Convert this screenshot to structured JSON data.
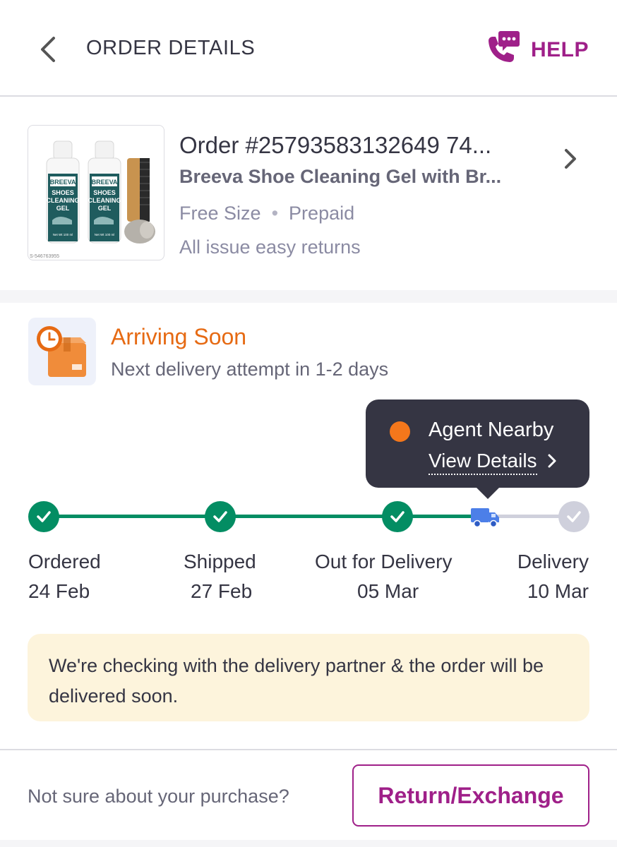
{
  "header": {
    "title": "ORDER DETAILS",
    "help_label": "HELP"
  },
  "product": {
    "order_id": "Order #25793583132649 74...",
    "name": "Breeva Shoe Cleaning Gel with Br...",
    "size": "Free Size",
    "payment": "Prepaid",
    "returns": "All issue easy returns",
    "image": {
      "bottle_brand": "BREEVA",
      "bottle_text_1": "SHOES",
      "bottle_text_2": "CLEANING",
      "bottle_text_3": "GEL",
      "bottle_net": "Net Wt 100 ml",
      "sku": "S-546763955"
    }
  },
  "status": {
    "title": "Arriving Soon",
    "subtitle": "Next delivery attempt in 1-2 days"
  },
  "tooltip": {
    "text": "Agent Nearby",
    "link": "View Details"
  },
  "timeline": {
    "steps": [
      {
        "label": "Ordered",
        "date": "24 Feb",
        "done": true
      },
      {
        "label": "Shipped",
        "date": "27 Feb",
        "done": true
      },
      {
        "label": "Out for Delivery",
        "date": "05 Mar",
        "done": true
      },
      {
        "label": "Delivery",
        "date": "10 Mar",
        "done": false
      }
    ]
  },
  "notice": {
    "text": "We're checking with the delivery partner & the order will be delivered soon."
  },
  "footer": {
    "prompt": "Not sure about your purchase?",
    "button": "Return/Exchange"
  },
  "colors": {
    "brand": "#9f2089",
    "done": "#038d63",
    "pending": "#cfd0dc",
    "truck": "#4c7fe8",
    "orange": "#e66a13",
    "notice_bg": "#fdf4dc",
    "tooltip_bg": "#353543"
  }
}
